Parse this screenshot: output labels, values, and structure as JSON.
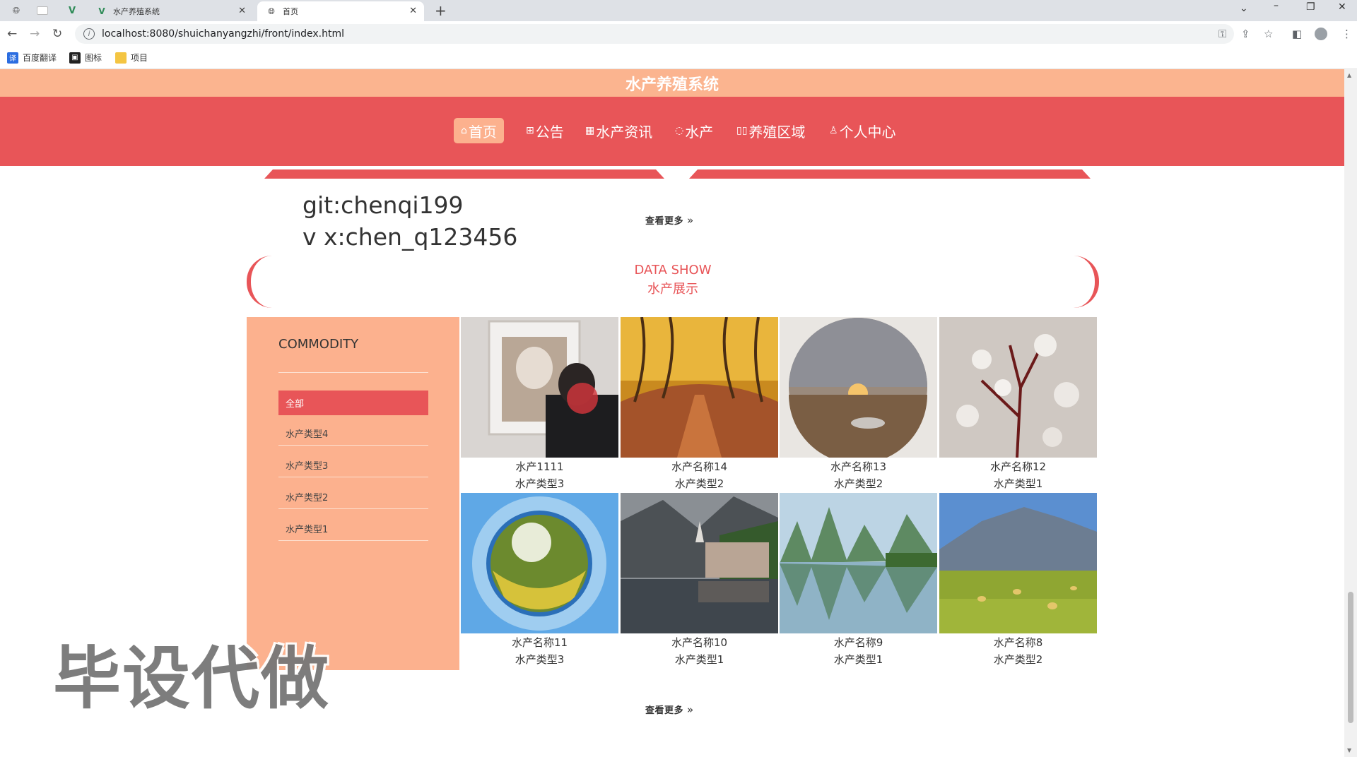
{
  "browser": {
    "tabs": [
      {
        "title": "水产养殖系统"
      },
      {
        "title": "首页"
      }
    ],
    "url": "localhost:8080/shuichanyangzhi/front/index.html",
    "bookmarks": [
      {
        "label": "百度翻译"
      },
      {
        "label": "图标"
      },
      {
        "label": "项目"
      }
    ]
  },
  "site": {
    "title": "水产养殖系统",
    "nav": [
      {
        "label": "首页",
        "icon": "⌂"
      },
      {
        "label": "公告",
        "icon": "⊞"
      },
      {
        "label": "水产资讯",
        "icon": "▦"
      },
      {
        "label": "水产",
        "icon": "◌"
      },
      {
        "label": "养殖区域",
        "icon": "▯▯"
      },
      {
        "label": "个人中心",
        "icon": "♙"
      }
    ]
  },
  "contact": {
    "line1": "git:chenqi199",
    "line2": "v x:chen_q123456"
  },
  "more_label": "查看更多",
  "section": {
    "title_en": "DATA SHOW",
    "title_cn": "水产展示"
  },
  "sidebar": {
    "title": "COMMODITY",
    "items": [
      {
        "label": "全部"
      },
      {
        "label": "水产类型4"
      },
      {
        "label": "水产类型3"
      },
      {
        "label": "水产类型2"
      },
      {
        "label": "水产类型1"
      }
    ]
  },
  "products": [
    {
      "name": "水产1111",
      "type": "水产类型3"
    },
    {
      "name": "水产名称14",
      "type": "水产类型2"
    },
    {
      "name": "水产名称13",
      "type": "水产类型2"
    },
    {
      "name": "水产名称12",
      "type": "水产类型1"
    },
    {
      "name": "水产名称11",
      "type": "水产类型3"
    },
    {
      "name": "水产名称10",
      "type": "水产类型1"
    },
    {
      "name": "水产名称9",
      "type": "水产类型1"
    },
    {
      "name": "水产名称8",
      "type": "水产类型2"
    }
  ],
  "watermark": "毕设代做",
  "colors": {
    "accent": "#e85558",
    "peach": "#fcb18e",
    "header": "#fbb48f"
  }
}
